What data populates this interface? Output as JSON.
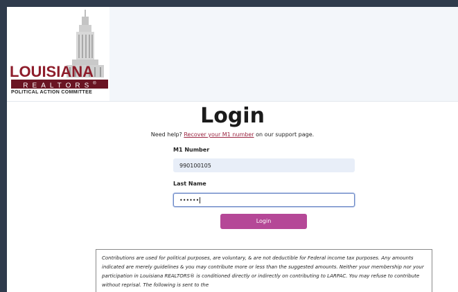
{
  "logo": {
    "state": "LOUISIANA",
    "org": "REALTORS",
    "registered": "®",
    "committee": "POLITICAL ACTION COMMITTEE"
  },
  "title": "Login",
  "help": {
    "prefix": "Need help?",
    "link": "Recover your M1 number",
    "suffix": "on our support page."
  },
  "form": {
    "m1_label": "M1 Number",
    "m1_value": "990100105",
    "last_name_label": "Last Name",
    "last_name_value": "••••••",
    "login_label": "Login"
  },
  "disclaimer": {
    "text": "Contributions are used for political purposes, are voluntary, & are not deductible for Federal income tax purposes. Any amounts indicated are merely guidelines & you may contribute more or less than the suggested amounts. Neither your membership nor your participation in Louisiana REALTORS® is conditioned directly or indirectly on contributing to LARPAC. You may refuse to contribute without reprisal. The following is sent to the"
  },
  "colors": {
    "brand": "#8e1d2b",
    "button": "#b54897",
    "link": "#9a2440"
  }
}
